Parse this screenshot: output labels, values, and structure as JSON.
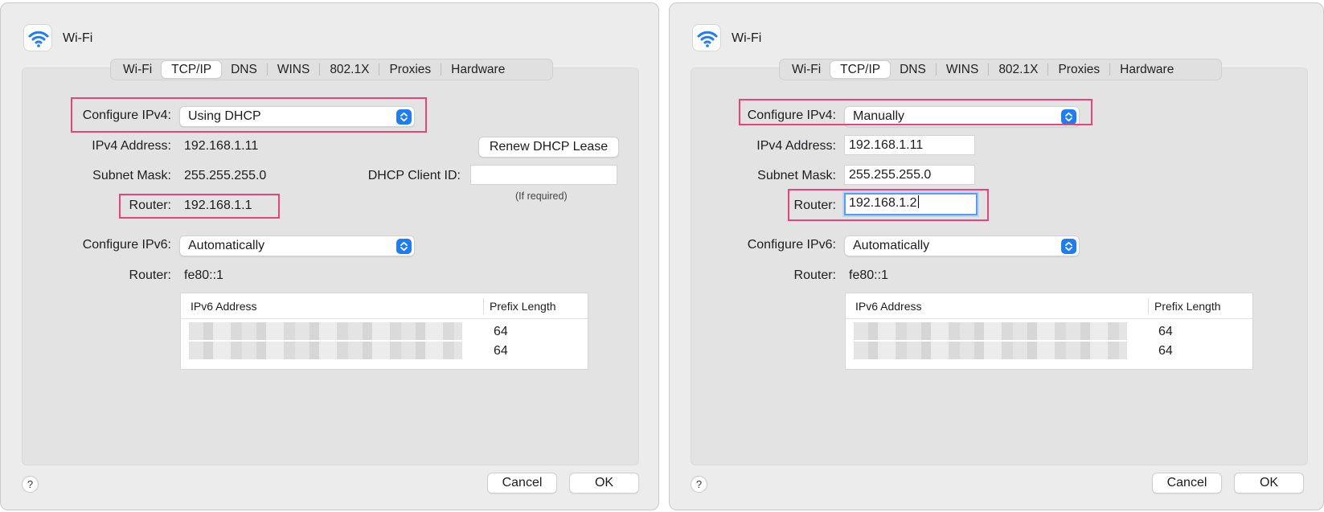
{
  "left": {
    "title": "Wi-Fi",
    "tabs": [
      "Wi-Fi",
      "TCP/IP",
      "DNS",
      "WINS",
      "802.1X",
      "Proxies",
      "Hardware"
    ],
    "active_tab": "TCP/IP",
    "configure_ipv4_label": "Configure IPv4:",
    "configure_ipv4_value": "Using DHCP",
    "ipv4_address_label": "IPv4 Address:",
    "ipv4_address": "192.168.1.11",
    "subnet_mask_label": "Subnet Mask:",
    "subnet_mask": "255.255.255.0",
    "router_label": "Router:",
    "router": "192.168.1.1",
    "renew_button": "Renew DHCP Lease",
    "dhcp_client_id_label": "DHCP Client ID:",
    "dhcp_client_id_value": "",
    "dhcp_hint": "(If required)",
    "configure_ipv6_label": "Configure IPv6:",
    "configure_ipv6_value": "Automatically",
    "ipv6_router_label": "Router:",
    "ipv6_router": "fe80::1",
    "table": {
      "col1": "IPv6 Address",
      "col2": "Prefix Length",
      "rows": [
        {
          "prefix": "64"
        },
        {
          "prefix": "64"
        }
      ]
    },
    "help": "?",
    "cancel": "Cancel",
    "ok": "OK"
  },
  "right": {
    "title": "Wi-Fi",
    "tabs": [
      "Wi-Fi",
      "TCP/IP",
      "DNS",
      "WINS",
      "802.1X",
      "Proxies",
      "Hardware"
    ],
    "active_tab": "TCP/IP",
    "configure_ipv4_label": "Configure IPv4:",
    "configure_ipv4_value": "Manually",
    "ipv4_address_label": "IPv4 Address:",
    "ipv4_address": "192.168.1.11",
    "subnet_mask_label": "Subnet Mask:",
    "subnet_mask": "255.255.255.0",
    "router_label": "Router:",
    "router": "192.168.1.2",
    "configure_ipv6_label": "Configure IPv6:",
    "configure_ipv6_value": "Automatically",
    "ipv6_router_label": "Router:",
    "ipv6_router": "fe80::1",
    "table": {
      "col1": "IPv6 Address",
      "col2": "Prefix Length",
      "rows": [
        {
          "prefix": "64"
        },
        {
          "prefix": "64"
        }
      ]
    },
    "help": "?",
    "cancel": "Cancel",
    "ok": "OK"
  },
  "colors": {
    "accent": "#1f7cf5",
    "highlight": "#e8447a",
    "panel_bg": "#e3e3e3",
    "window_bg": "#ececec"
  },
  "icons": {
    "window": "wifi-icon",
    "popup": "chevron-up-down-icon"
  }
}
